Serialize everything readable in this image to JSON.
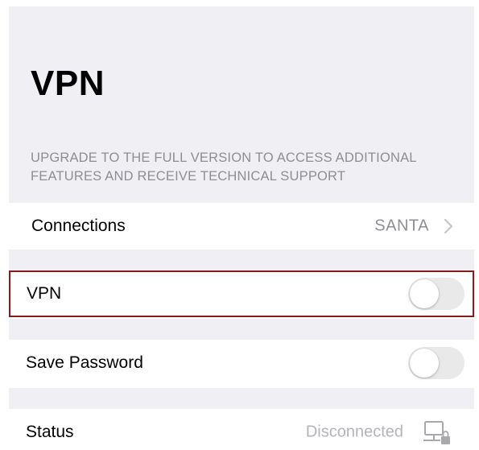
{
  "header": {
    "title": "VPN",
    "upgrade_note": "UPGRADE TO THE FULL VERSION TO ACCESS ADDITIONAL FEATURES AND RECEIVE TECHNICAL SUPPORT"
  },
  "connections": {
    "label": "Connections",
    "value": "SANTA",
    "icon": "chevron-right-icon"
  },
  "vpn": {
    "label": "VPN",
    "enabled": false,
    "highlight_color": "#8b1a1a"
  },
  "save_password": {
    "label": "Save Password",
    "enabled": false
  },
  "status": {
    "label": "Status",
    "value": "Disconnected",
    "icon": "network-disconnected-icon"
  },
  "colors": {
    "background": "#efeff4",
    "secondary_text": "#8e8e93",
    "toggle_off": "#e9e9ea"
  }
}
